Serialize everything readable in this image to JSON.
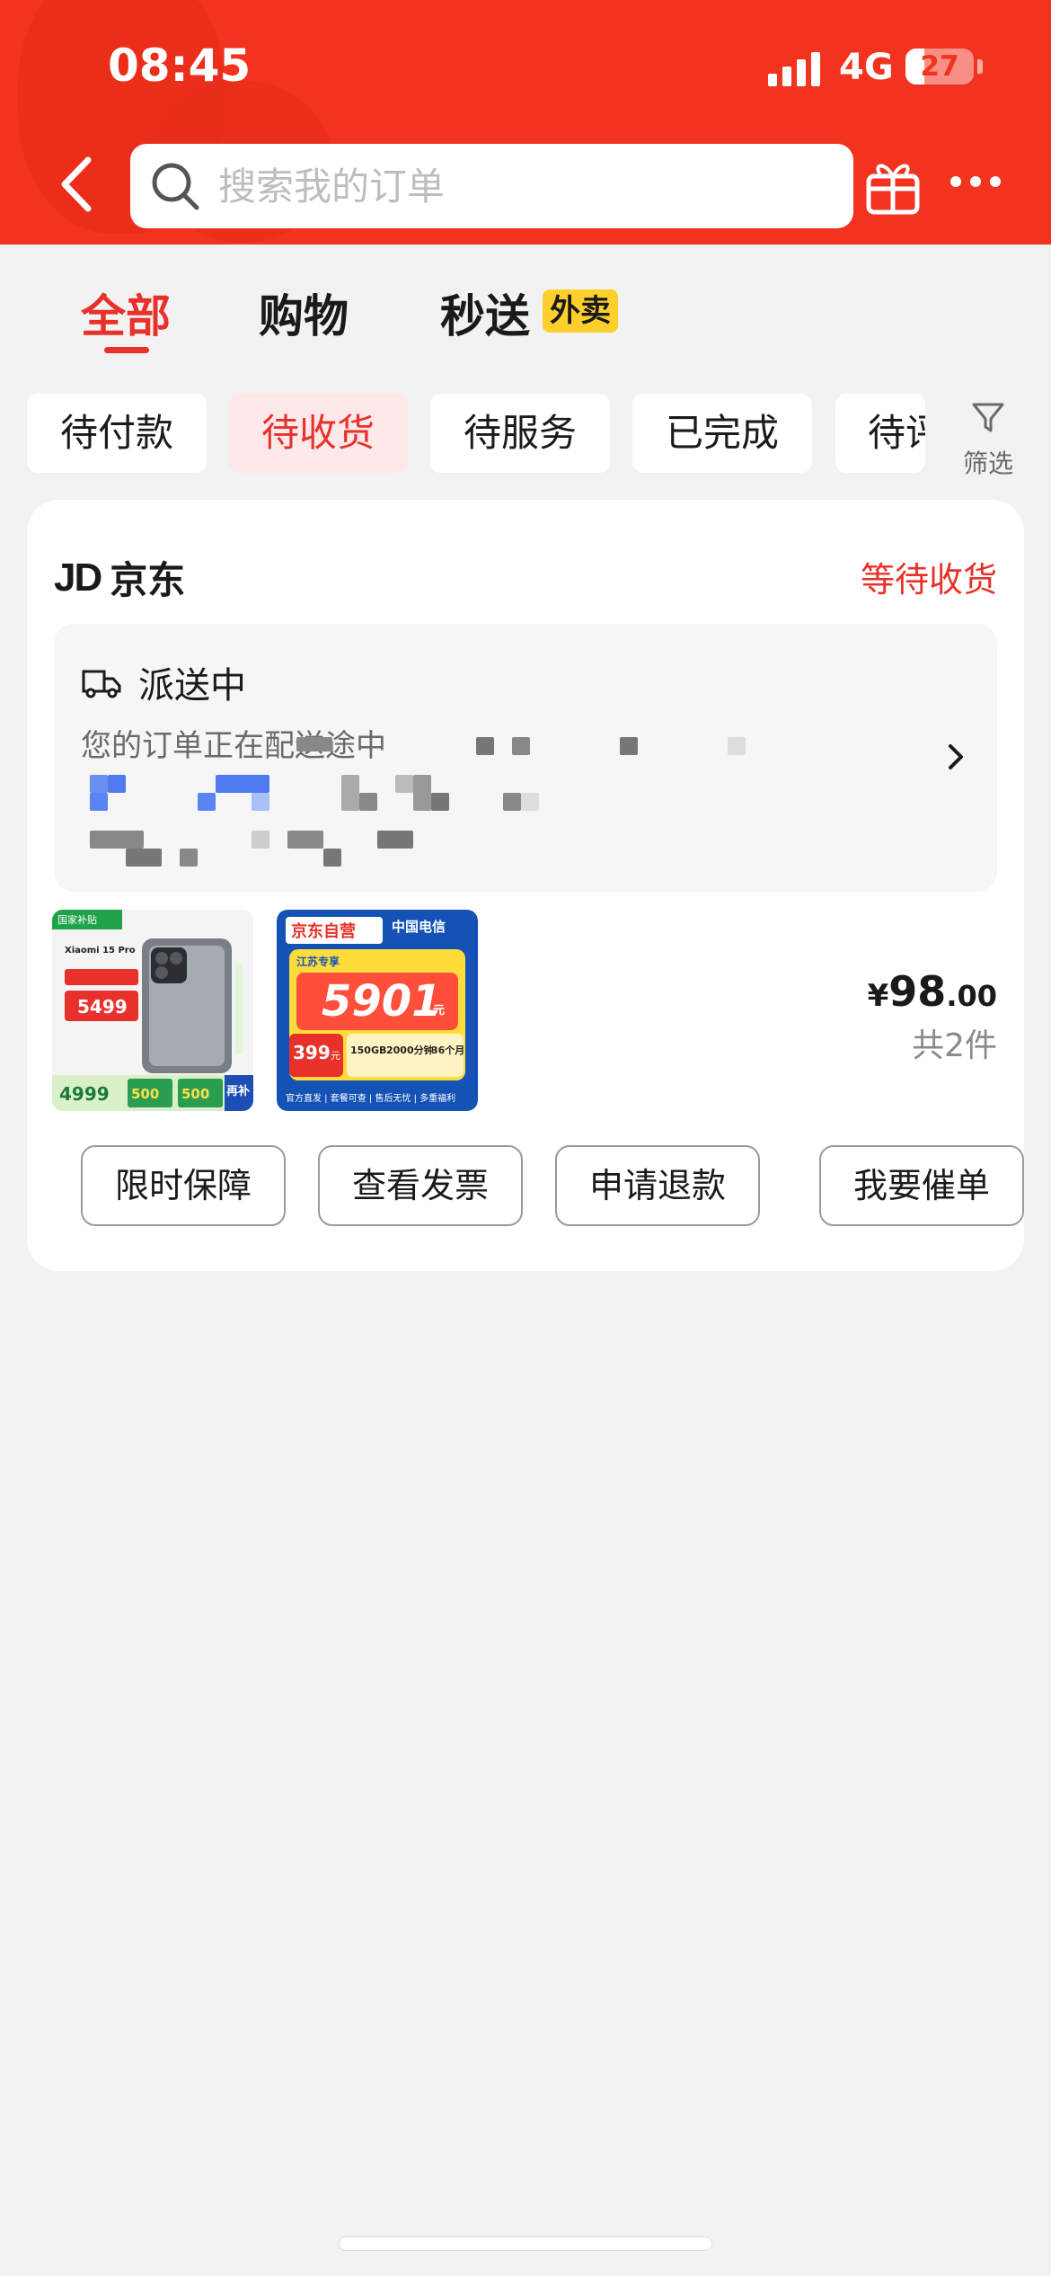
{
  "status_bar": {
    "time": "08:45",
    "network": "4G",
    "battery": "27",
    "battery_level": 0.27
  },
  "header": {
    "search_placeholder": "搜索我的订单",
    "icons": [
      "back-chevron-icon",
      "search-icon",
      "gift-icon",
      "more-icon"
    ],
    "brand_color": "#f2331f"
  },
  "tabs": [
    {
      "label": "全部",
      "active": true
    },
    {
      "label": "购物",
      "active": false
    },
    {
      "label": "秒送",
      "active": false,
      "badge": "外卖"
    }
  ],
  "filters": {
    "chips": [
      "待付款",
      "待收货",
      "待服务",
      "已完成",
      "待评价"
    ],
    "active_chip": "待收货",
    "filter_label": "筛选"
  },
  "order": {
    "shop_logo": "JD",
    "shop_name": "京东",
    "status": "等待收货",
    "shipping": {
      "title": "派送中",
      "description": "您的订单正在配送途中"
    },
    "products": [
      {
        "name": "phone-product",
        "tag": "国家补贴",
        "model": "Xiaomi 15 Pro",
        "price_tag": "5499",
        "sub_price": "4999",
        "bonus_1": "500",
        "bonus_2": "500",
        "bonus_label": "再补"
      },
      {
        "name": "telecom-product",
        "tag": "京东自营",
        "carrier": "中国电信",
        "promo": "江苏专享",
        "amount": "5901",
        "unit": "元",
        "plan_price": "399",
        "plan_unit": "元",
        "data_label": "150GB",
        "minutes": "2000分钟",
        "months": "36个月",
        "footer": "官方直发 | 套餐可查 | 售后无忧 | 多重福利"
      }
    ],
    "price_symbol": "¥",
    "price_int": "98",
    "price_dec": ".00",
    "item_count": "共2件",
    "actions": [
      "限时保障",
      "查看发票",
      "申请退款",
      "我要催单"
    ]
  },
  "colors": {
    "accent_red": "#e8312b",
    "chip_active_bg": "#fde8ea",
    "waimai_yellow": "#ffd02c"
  }
}
